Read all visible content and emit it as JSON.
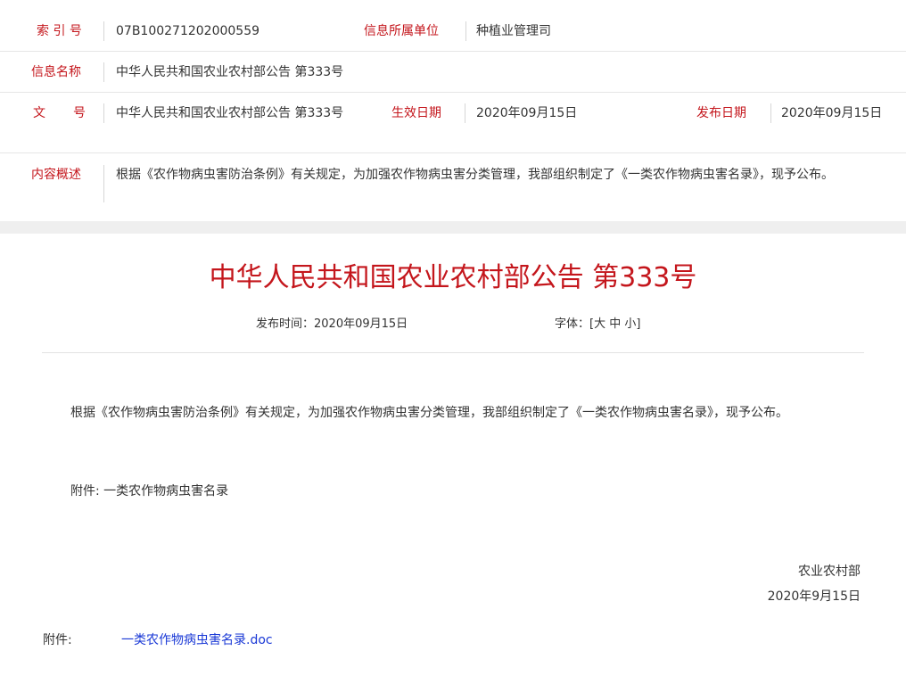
{
  "meta": {
    "index_label": "索 引 号",
    "index_value": "07B100271202000559",
    "unit_label": "信息所属单位",
    "unit_value": "种植业管理司",
    "name_label": "信息名称",
    "name_value": "中华人民共和国农业农村部公告 第333号",
    "docno_label_1": "文",
    "docno_label_2": "号",
    "docno_value": "中华人民共和国农业农村部公告 第333号",
    "effective_label": "生效日期",
    "effective_value": "2020年09月15日",
    "publish_label": "发布日期",
    "publish_value": "2020年09月15日",
    "summary_label": "内容概述",
    "summary_value": "根据《农作物病虫害防治条例》有关规定，为加强农作物病虫害分类管理，我部组织制定了《一类农作物病虫害名录》，现予公布。"
  },
  "article": {
    "title": "中华人民共和国农业农村部公告 第333号",
    "publish_time_label": "发布时间：",
    "publish_time_value": "2020年09月15日",
    "font_label": "字体：",
    "font_open": "[",
    "font_large": "大",
    "font_medium": "中",
    "font_small": "小",
    "font_close": "]",
    "body_para": "根据《农作物病虫害防治条例》有关规定，为加强农作物病虫害分类管理，我部组织制定了《一类农作物病虫害名录》，现予公布。",
    "attachment_line": "附件: 一类农作物病虫害名录",
    "signature_org": "农业农村部",
    "signature_date": "2020年9月15日",
    "attachment_label": "附件:",
    "attachment_link": "一类农作物病虫害名录.doc"
  }
}
